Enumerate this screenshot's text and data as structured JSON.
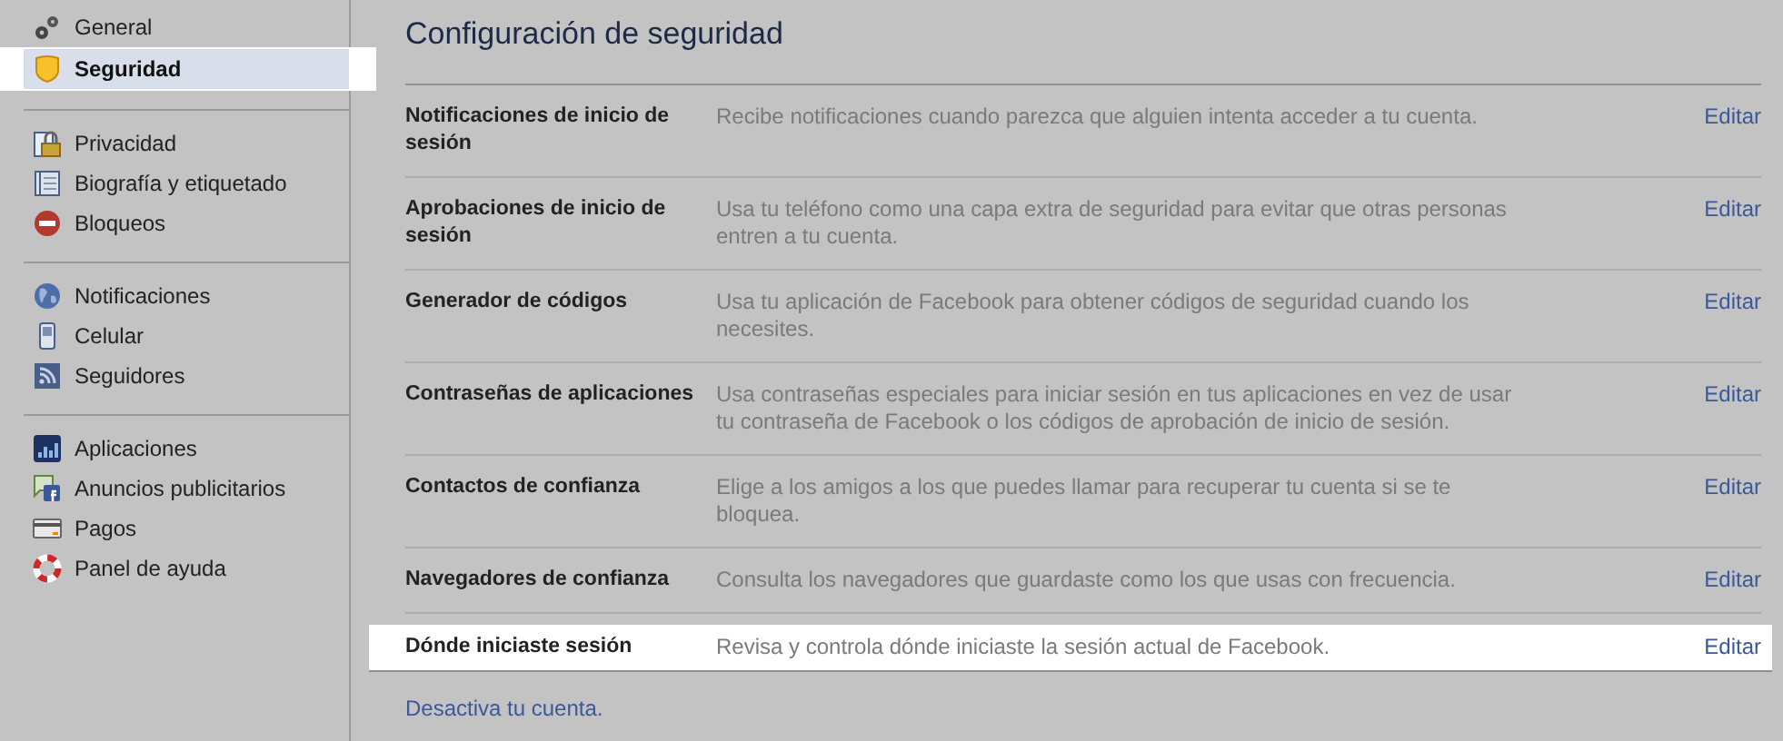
{
  "sidebar": {
    "groups": [
      {
        "items": [
          {
            "label": "General",
            "selected": false,
            "highlighted": false
          },
          {
            "label": "Seguridad",
            "selected": true,
            "highlighted": true
          }
        ]
      },
      {
        "items": [
          {
            "label": "Privacidad",
            "selected": false,
            "highlighted": false
          },
          {
            "label": "Biografía y etiquetado",
            "selected": false,
            "highlighted": false
          },
          {
            "label": "Bloqueos",
            "selected": false,
            "highlighted": false
          }
        ]
      },
      {
        "items": [
          {
            "label": "Notificaciones",
            "selected": false,
            "highlighted": false
          },
          {
            "label": "Celular",
            "selected": false,
            "highlighted": false
          },
          {
            "label": "Seguidores",
            "selected": false,
            "highlighted": false
          }
        ]
      },
      {
        "items": [
          {
            "label": "Aplicaciones",
            "selected": false,
            "highlighted": false
          },
          {
            "label": "Anuncios publicitarios",
            "selected": false,
            "highlighted": false
          },
          {
            "label": "Pagos",
            "selected": false,
            "highlighted": false
          },
          {
            "label": "Panel de ayuda",
            "selected": false,
            "highlighted": false
          }
        ]
      }
    ]
  },
  "title": "Configuración de seguridad",
  "settings": [
    {
      "label": "Notificaciones de inicio de sesión",
      "description": "Recibe notificaciones cuando parezca que alguien intenta acceder a tu cuenta.",
      "action": "Editar",
      "highlighted": false
    },
    {
      "label": "Aprobaciones de inicio de sesión",
      "description": "Usa tu teléfono como una capa extra de seguridad para evitar que otras personas entren a tu cuenta.",
      "action": "Editar",
      "highlighted": false
    },
    {
      "label": "Generador de códigos",
      "description": "Usa tu aplicación de Facebook para obtener códigos de seguridad cuando los necesites.",
      "action": "Editar",
      "highlighted": false
    },
    {
      "label": "Contraseñas de aplicaciones",
      "description": "Usa contraseñas especiales para iniciar sesión en tus aplicaciones en vez de usar tu contraseña de Facebook o los códigos de aprobación de inicio de sesión.",
      "action": "Editar",
      "highlighted": false
    },
    {
      "label": "Contactos de confianza",
      "description": "Elige a los amigos a los que puedes llamar para recuperar tu cuenta si se te bloquea.",
      "action": "Editar",
      "highlighted": false
    },
    {
      "label": "Navegadores de confianza",
      "description": "Consulta los navegadores que guardaste como los que usas con frecuencia.",
      "action": "Editar",
      "highlighted": false
    },
    {
      "label": "Dónde iniciaste sesión",
      "description": "Revisa y controla dónde iniciaste la sesión actual de Facebook.",
      "action": "Editar",
      "highlighted": true
    }
  ],
  "footer_link": "Desactiva tu cuenta."
}
